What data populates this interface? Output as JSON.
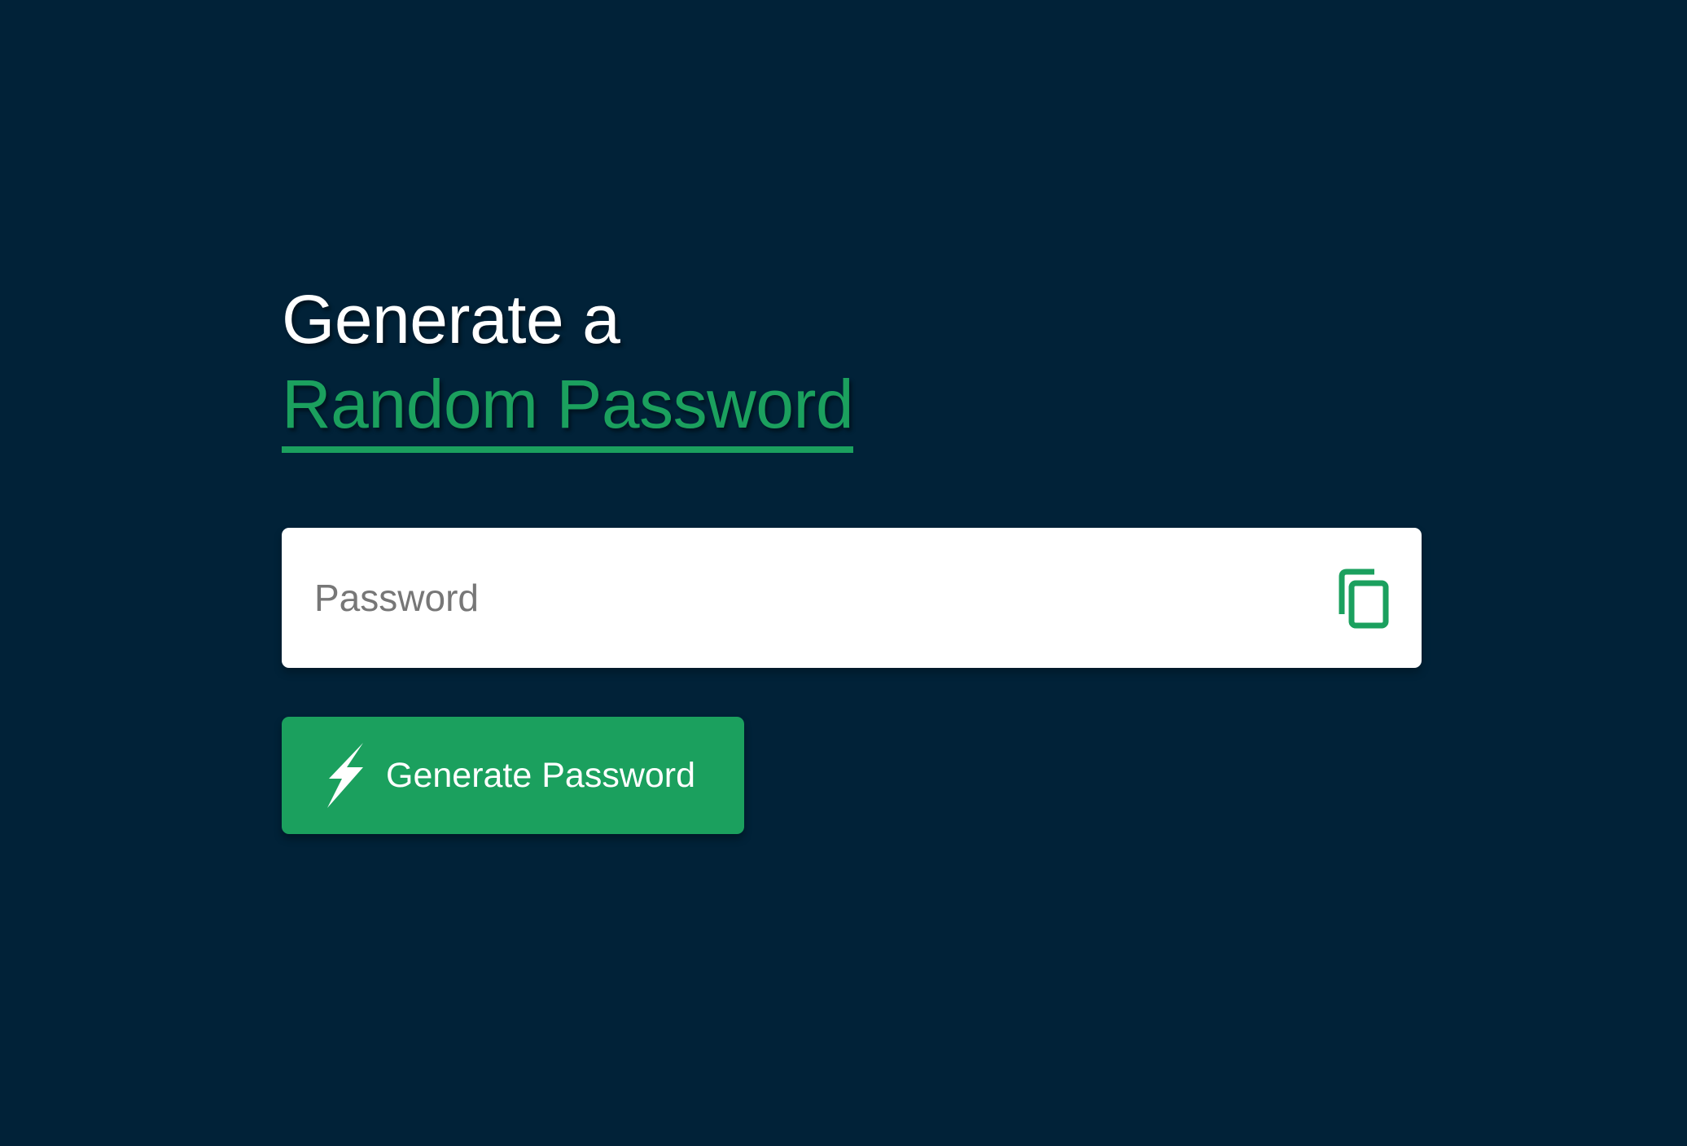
{
  "heading": {
    "line1": "Generate a",
    "line2": "Random Password"
  },
  "password_field": {
    "placeholder": "Password",
    "value": ""
  },
  "copy_button": {
    "icon": "copy-icon"
  },
  "generate_button": {
    "label": "Generate Password",
    "icon": "lightning-bolt-icon"
  },
  "colors": {
    "background": "#012238",
    "accent": "#1ba05e",
    "heading_text": "#ffffff",
    "placeholder_text": "#777777"
  }
}
